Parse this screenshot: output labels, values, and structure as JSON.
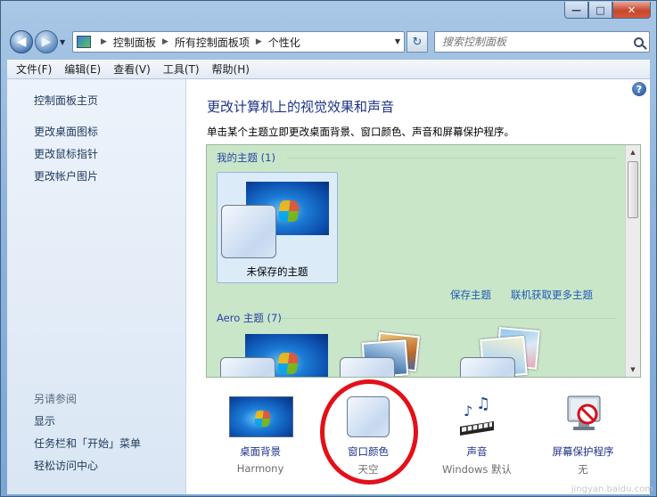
{
  "window": {
    "caption_buttons": {
      "minimize": "—",
      "maximize": "□",
      "close": "✕"
    }
  },
  "nav": {
    "back_glyph": "◀",
    "forward_glyph": "▶",
    "breadcrumb": [
      "控制面板",
      "所有控制面板项",
      "个性化"
    ],
    "refresh_glyph": "↻",
    "search_placeholder": "搜索控制面板"
  },
  "menu": [
    "文件(F)",
    "编辑(E)",
    "查看(V)",
    "工具(T)",
    "帮助(H)"
  ],
  "sidebar": {
    "home": "控制面板主页",
    "links": [
      "更改桌面图标",
      "更改鼠标指针",
      "更改帐户图片"
    ],
    "see_also_heading": "另请参阅",
    "see_also": [
      "显示",
      "任务栏和「开始」菜单",
      "轻松访问中心"
    ]
  },
  "main": {
    "help": "?",
    "title": "更改计算机上的视觉效果和声音",
    "description": "单击某个主题立即更改桌面背景、窗口颜色、声音和屏幕保护程序。",
    "my_themes_heading": "我的主题 (1)",
    "unsaved_theme_label": "未保存的主题",
    "save_theme_link": "保存主题",
    "more_themes_link": "联机获取更多主题",
    "aero_heading": "Aero 主题 (7)"
  },
  "bottom": [
    {
      "label": "桌面背景",
      "sub": "Harmony",
      "icon": "wallpaper-icon"
    },
    {
      "label": "窗口颜色",
      "sub": "天空",
      "icon": "window-color-icon"
    },
    {
      "label": "声音",
      "sub": "Windows 默认",
      "icon": "sound-icon"
    },
    {
      "label": "屏幕保护程序",
      "sub": "无",
      "icon": "screensaver-icon"
    }
  ],
  "watermark": "jingyan.baidu.com",
  "colors": {
    "highlight_ring": "#e3101a",
    "panel_green": "#c9e6c9",
    "link_blue": "#1e3287"
  }
}
